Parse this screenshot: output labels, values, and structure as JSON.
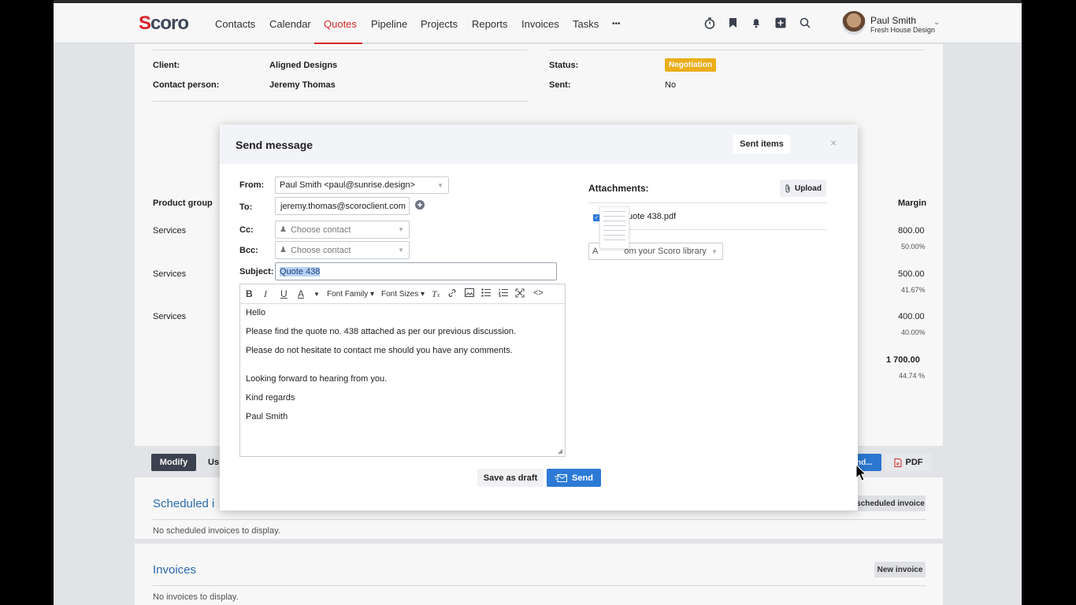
{
  "brand": {
    "logo": "Scoro",
    "logo_first": "S",
    "logo_rest": "coro",
    "accent": "#d92b2b",
    "primary": "#2d7ad6"
  },
  "nav": {
    "items": [
      "Contacts",
      "Calendar",
      "Quotes",
      "Pipeline",
      "Projects",
      "Reports",
      "Invoices",
      "Tasks"
    ],
    "active": "Quotes",
    "more": "•••"
  },
  "user": {
    "name": "Paul Smith",
    "company": "Fresh House Design"
  },
  "quote": {
    "client_label": "Client:",
    "client": "Aligned Designs",
    "contact_label": "Contact person:",
    "contact": "Jeremy Thomas",
    "status_label": "Status:",
    "status": "Negotiation",
    "sent_label": "Sent:",
    "sent": "No"
  },
  "lines": {
    "header_left": "Product group",
    "header_right": "Margin",
    "rows": [
      {
        "group": "Services",
        "margin": "800.00",
        "pct": "50.00%"
      },
      {
        "group": "Services",
        "margin": "500.00",
        "pct": "41.67%"
      },
      {
        "group": "Services",
        "margin": "400.00",
        "pct": "40.00%"
      }
    ],
    "total": "1 700.00",
    "total_pct": "44.74 %"
  },
  "actions": {
    "modify": "Modify",
    "use_partial": "Us",
    "send_partial": "nd...",
    "pdf": "PDF"
  },
  "scheduled": {
    "title": "Scheduled invoices",
    "title_visible": "Scheduled i",
    "button": "scheduled invoice",
    "empty": "No scheduled invoices to display."
  },
  "invoices": {
    "title": "Invoices",
    "button": "New invoice",
    "empty": "No invoices to display."
  },
  "modal": {
    "title": "Send message",
    "sent_items": "Sent items",
    "close": "×",
    "from_label": "From:",
    "from": "Paul Smith <paul@sunrise.design>",
    "to_label": "To:",
    "to": "jeremy.thomas@scoroclient.com",
    "cc_label": "Cc:",
    "cc_placeholder": "Choose contact",
    "bcc_label": "Bcc:",
    "bcc_placeholder": "Choose contact",
    "subject_label": "Subject:",
    "subject": "Quote 438",
    "toolbar": {
      "font_family": "Font Family",
      "font_sizes": "Font Sizes"
    },
    "body": [
      "Hello",
      "Please find the quote no. 438 attached as per our previous discussion.",
      "Please do not hesitate to contact me should you have any comments.",
      "Looking forward to hearing from you.",
      "Kind regards",
      "Paul Smith"
    ],
    "attachments_label": "Attachments:",
    "upload": "Upload",
    "attachment_file": "uote 438.pdf",
    "library_placeholder": "om your Scoro library",
    "library_prefix": "A",
    "save_draft": "Save as draft",
    "send": "Send"
  }
}
